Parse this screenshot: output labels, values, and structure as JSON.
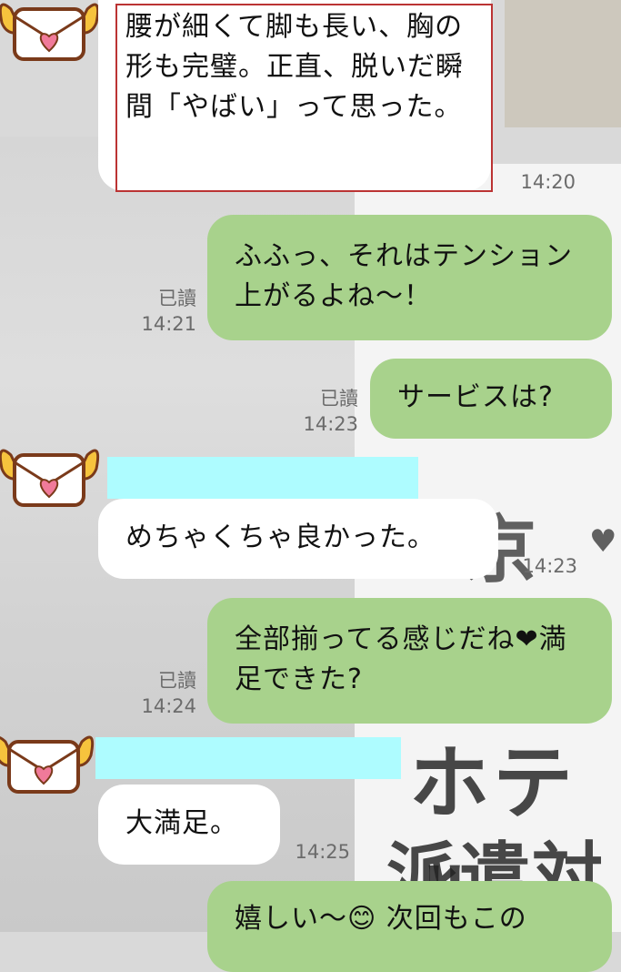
{
  "messages": [
    {
      "side": "in",
      "text": "腰が細くて脚も長い、胸の形も完璧。正直、脱いだ瞬間「やばい」って思った。",
      "time": "14:20"
    },
    {
      "side": "out",
      "text": "ふふっ、それはテンション上がるよね～！",
      "read": "已讀",
      "time": "14:21"
    },
    {
      "side": "out",
      "text": "サービスは?",
      "read": "已讀",
      "time": "14:23"
    },
    {
      "side": "in",
      "text": "めちゃくちゃ良かった。",
      "time": "14:23"
    },
    {
      "side": "out",
      "text": "全部揃ってる感じだね❤満足できた?",
      "read": "已讀",
      "time": "14:24"
    },
    {
      "side": "in",
      "text": "大満足。",
      "time": "14:25"
    },
    {
      "side": "out",
      "text": "嬉しい～😊 次回もこの"
    }
  ],
  "background_text": {
    "hotel": "ホテル",
    "dispatch": "派遣対",
    "kyo": "京",
    "heart": "♥"
  },
  "colors": {
    "outgoing_bubble": "#a8d28c",
    "incoming_bubble": "#ffffff",
    "name_redaction": "#aefcff"
  },
  "icons": {
    "avatar": "winged-love-letter-icon"
  }
}
